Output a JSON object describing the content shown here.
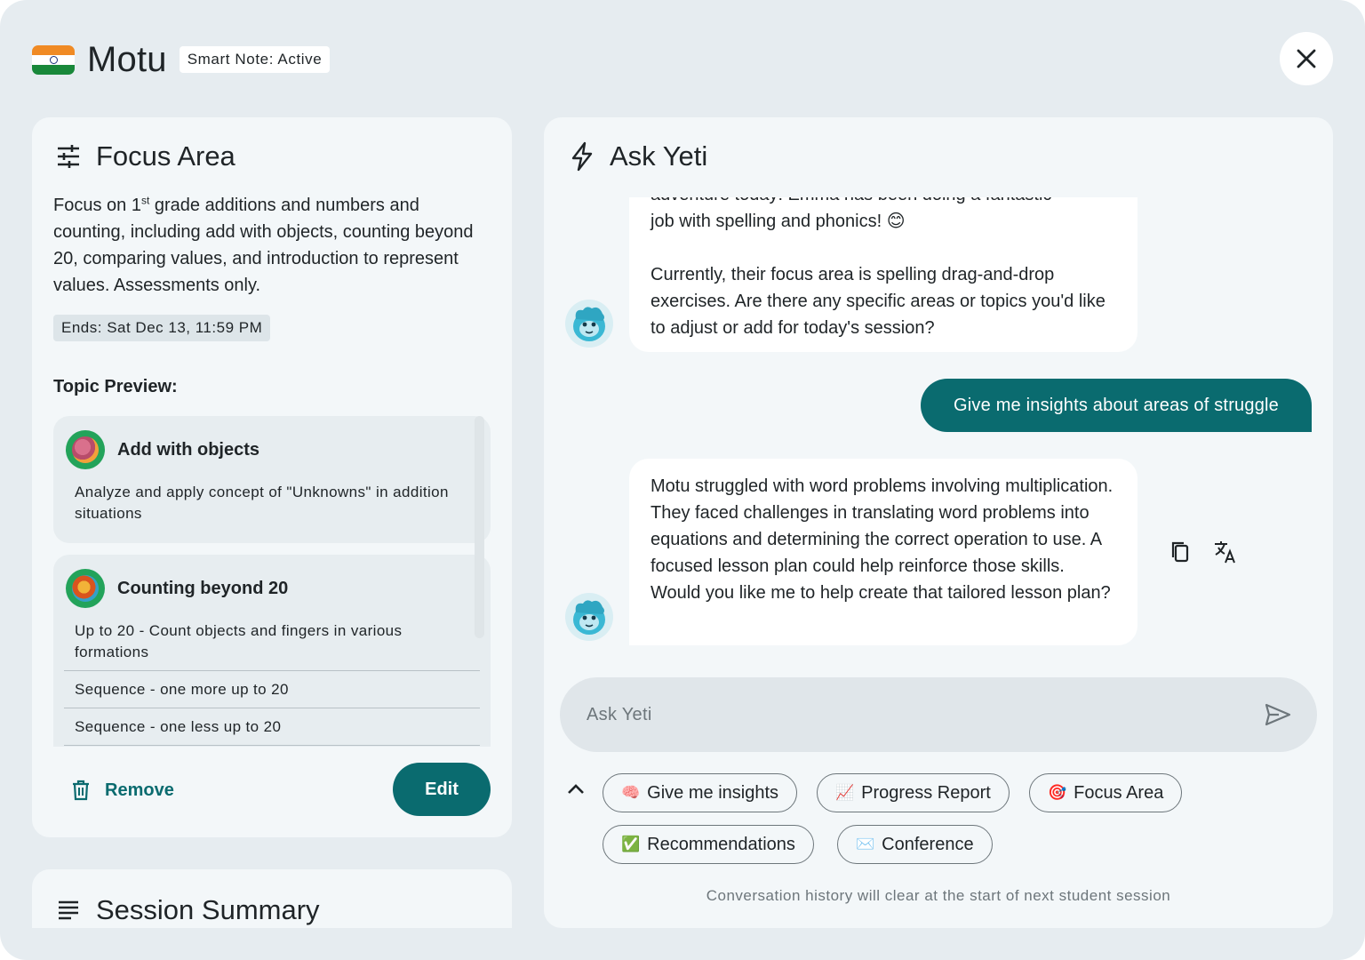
{
  "header": {
    "student_name": "Motu",
    "badge": "Smart Note: Active",
    "flag_icon": "india-flag-icon"
  },
  "focus_area": {
    "title": "Focus Area",
    "description_pre": "Focus on 1",
    "description_sup": "st",
    "description_post": " grade additions and numbers and counting, including add with objects, counting beyond 20, comparing values, and introduction to represent values. Assessments only.",
    "ends": "Ends: Sat Dec 13, 11:59 PM",
    "topic_preview_label": "Topic Preview:",
    "topics": [
      {
        "name": "Add with objects",
        "description": "Analyze and apply concept of \"Unknowns\" in addition situations"
      },
      {
        "name": "Counting beyond 20",
        "description": "Up to 20 - Count objects and fingers in various formations",
        "subitems": [
          "Sequence - one more up to 20",
          "Sequence - one less up to 20"
        ]
      }
    ],
    "remove_label": "Remove",
    "edit_label": "Edit"
  },
  "session_summary": {
    "title": "Session Summary"
  },
  "chat": {
    "title": "Ask Yeti",
    "messages": [
      {
        "role": "bot",
        "partial_line": "adventure today! Emma has been doing a fantastic",
        "line1": "job with spelling and phonics! 😊",
        "line2": "Currently, their focus area is spelling drag-and-drop exercises. Are there any specific areas or topics you'd like to adjust or add for today's session?"
      },
      {
        "role": "user",
        "text": "Give me insights about areas of struggle"
      },
      {
        "role": "bot",
        "text": "Motu struggled with word problems involving multiplication. They faced challenges in translating word problems into equations and determining the correct operation to use. A focused lesson plan could help reinforce those skills. Would you like me to help create that tailored lesson plan?"
      }
    ],
    "input_placeholder": "Ask Yeti",
    "input_value": "",
    "chips": [
      {
        "emoji": "🧠",
        "label": "Give me insights"
      },
      {
        "emoji": "📈",
        "label": "Progress Report"
      },
      {
        "emoji": "🎯",
        "label": "Focus Area"
      },
      {
        "emoji": "✅",
        "label": "Recommendations"
      },
      {
        "emoji": "✉️",
        "label": "Conference"
      }
    ],
    "footer_note": "Conversation history will clear at the start of next student session"
  },
  "colors": {
    "background": "#e6ecf0",
    "panel": "#f3f7f9",
    "accent": "#0a6b6f",
    "chip_border": "#6d767b"
  }
}
